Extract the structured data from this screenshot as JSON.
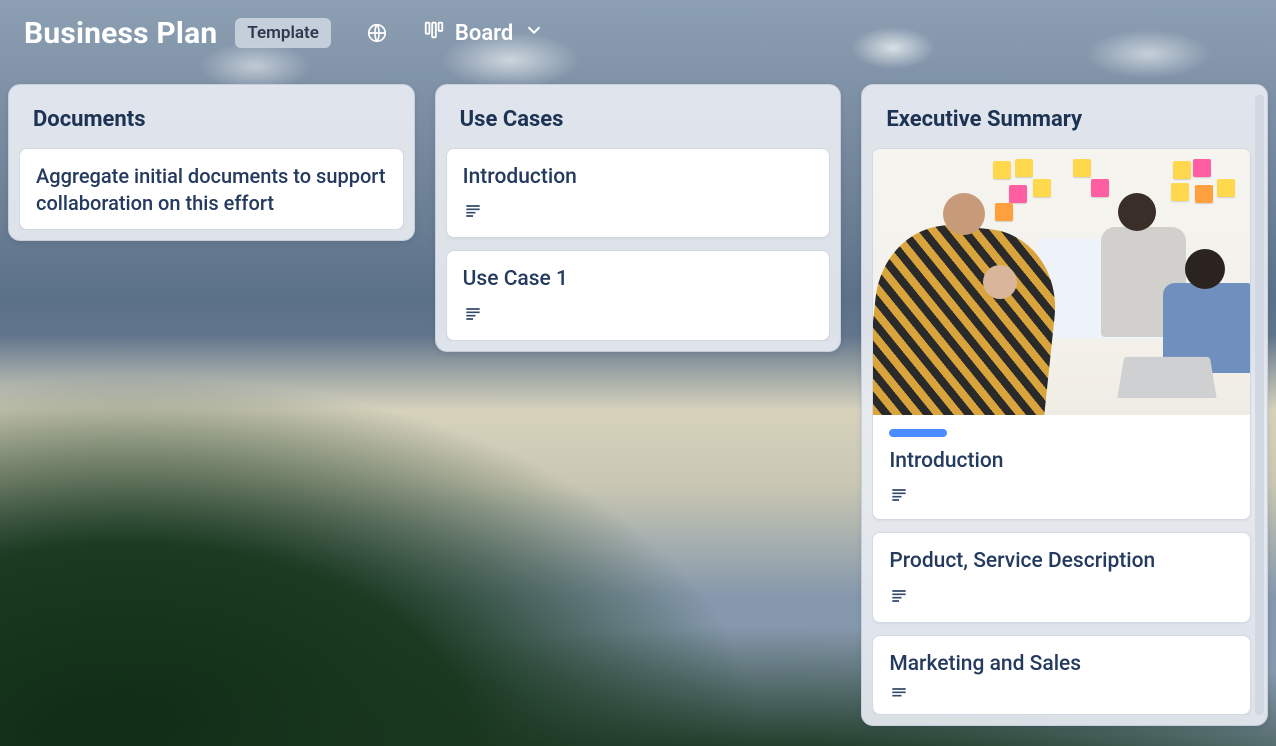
{
  "header": {
    "title": "Business Plan",
    "template_label": "Template",
    "view_label": "Board"
  },
  "columns": [
    {
      "title": "Documents",
      "cards": [
        {
          "title": "Aggregate initial documents to support collaboration on this effort",
          "has_description": false,
          "has_image": false,
          "has_tag": false
        }
      ]
    },
    {
      "title": "Use Cases",
      "cards": [
        {
          "title": "Introduction",
          "has_description": true,
          "has_image": false,
          "has_tag": false
        },
        {
          "title": "Use Case 1",
          "has_description": true,
          "has_image": false,
          "has_tag": false
        }
      ]
    },
    {
      "title": "Executive Summary",
      "cards": [
        {
          "title": "Introduction",
          "has_description": true,
          "has_image": true,
          "has_tag": true
        },
        {
          "title": "Product, Service Description",
          "has_description": true,
          "has_image": false,
          "has_tag": false
        },
        {
          "title": "Marketing and Sales",
          "has_description": true,
          "has_image": false,
          "has_tag": false
        }
      ]
    }
  ]
}
